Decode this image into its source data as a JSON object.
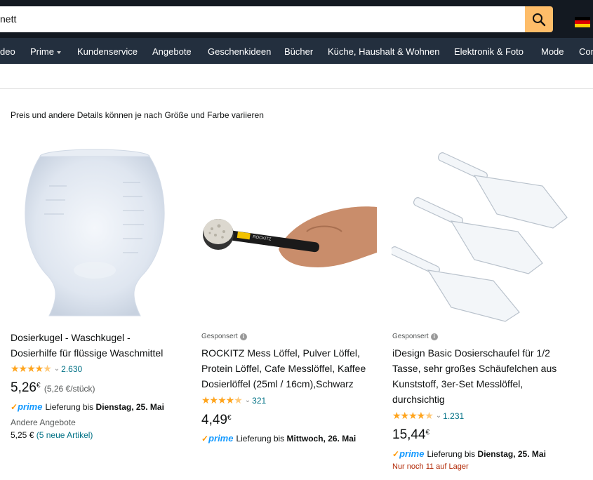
{
  "search": {
    "value": "nett"
  },
  "nav": {
    "items": [
      "deo",
      "Prime",
      "Kundenservice",
      "Angebote",
      "Geschenkideen",
      "Bücher",
      "Küche, Haushalt & Wohnen",
      "Elektronik & Foto",
      "Mode",
      "Cor"
    ]
  },
  "notice": "Preis und andere Details können je nach Größe und Farbe variieren",
  "products": [
    {
      "sponsored": "",
      "title_line1": "Dosierkugel - Waschkugel -",
      "title_line2": "Dosierhilfe für flüssige Waschmittel",
      "stars": 4.5,
      "rating_count": "2.630",
      "price_main": "5,26",
      "price_currency": "€",
      "unit_price": "(5,26 €/stück)",
      "prime": "prime",
      "delivery_text": "Lieferung bis",
      "delivery_date": "Dienstag, 25. Mai",
      "other_offers": "Andere Angebote",
      "other_price": "5,25 €",
      "other_link": "(5 neue Artikel)"
    },
    {
      "sponsored": "Gesponsert",
      "title_line1": "ROCKITZ Mess Löffel, Pulver Löffel,",
      "title_line2": "Protein Löffel, Cafe Messlöffel, Kaffee",
      "title_line3": "Dosierlöffel (25ml / 16cm),Schwarz",
      "stars": 4.5,
      "rating_count": "321",
      "price_main": "4,49",
      "price_currency": "€",
      "prime": "prime",
      "delivery_text": "Lieferung bis",
      "delivery_date": "Mittwoch, 26. Mai",
      "logo_text": "ROCKITZ"
    },
    {
      "sponsored": "Gesponsert",
      "title_line1": "iDesign Basic Dosierschaufel für 1/2",
      "title_line2": "Tasse, sehr großes Schäufelchen aus",
      "title_line3": "Kunststoff, 3er-Set Messlöffel,",
      "title_line4": "durchsichtig",
      "stars": 4.5,
      "rating_count": "1.231",
      "price_main": "15,44",
      "price_currency": "€",
      "prime": "prime",
      "delivery_text": "Lieferung bis",
      "delivery_date": "Dienstag, 25. Mai",
      "stock": "Nur noch 11 auf Lager"
    }
  ],
  "icons": {
    "search": "search-icon",
    "flag": "germany-flag-icon",
    "info": "info-icon",
    "star": "star-icon"
  },
  "colors": {
    "topbar": "#131921",
    "nav": "#232f3e",
    "search_button": "#febd69",
    "link": "#007185",
    "star": "#ffa41c",
    "prime": "#1399ff",
    "stock": "#b12704"
  }
}
